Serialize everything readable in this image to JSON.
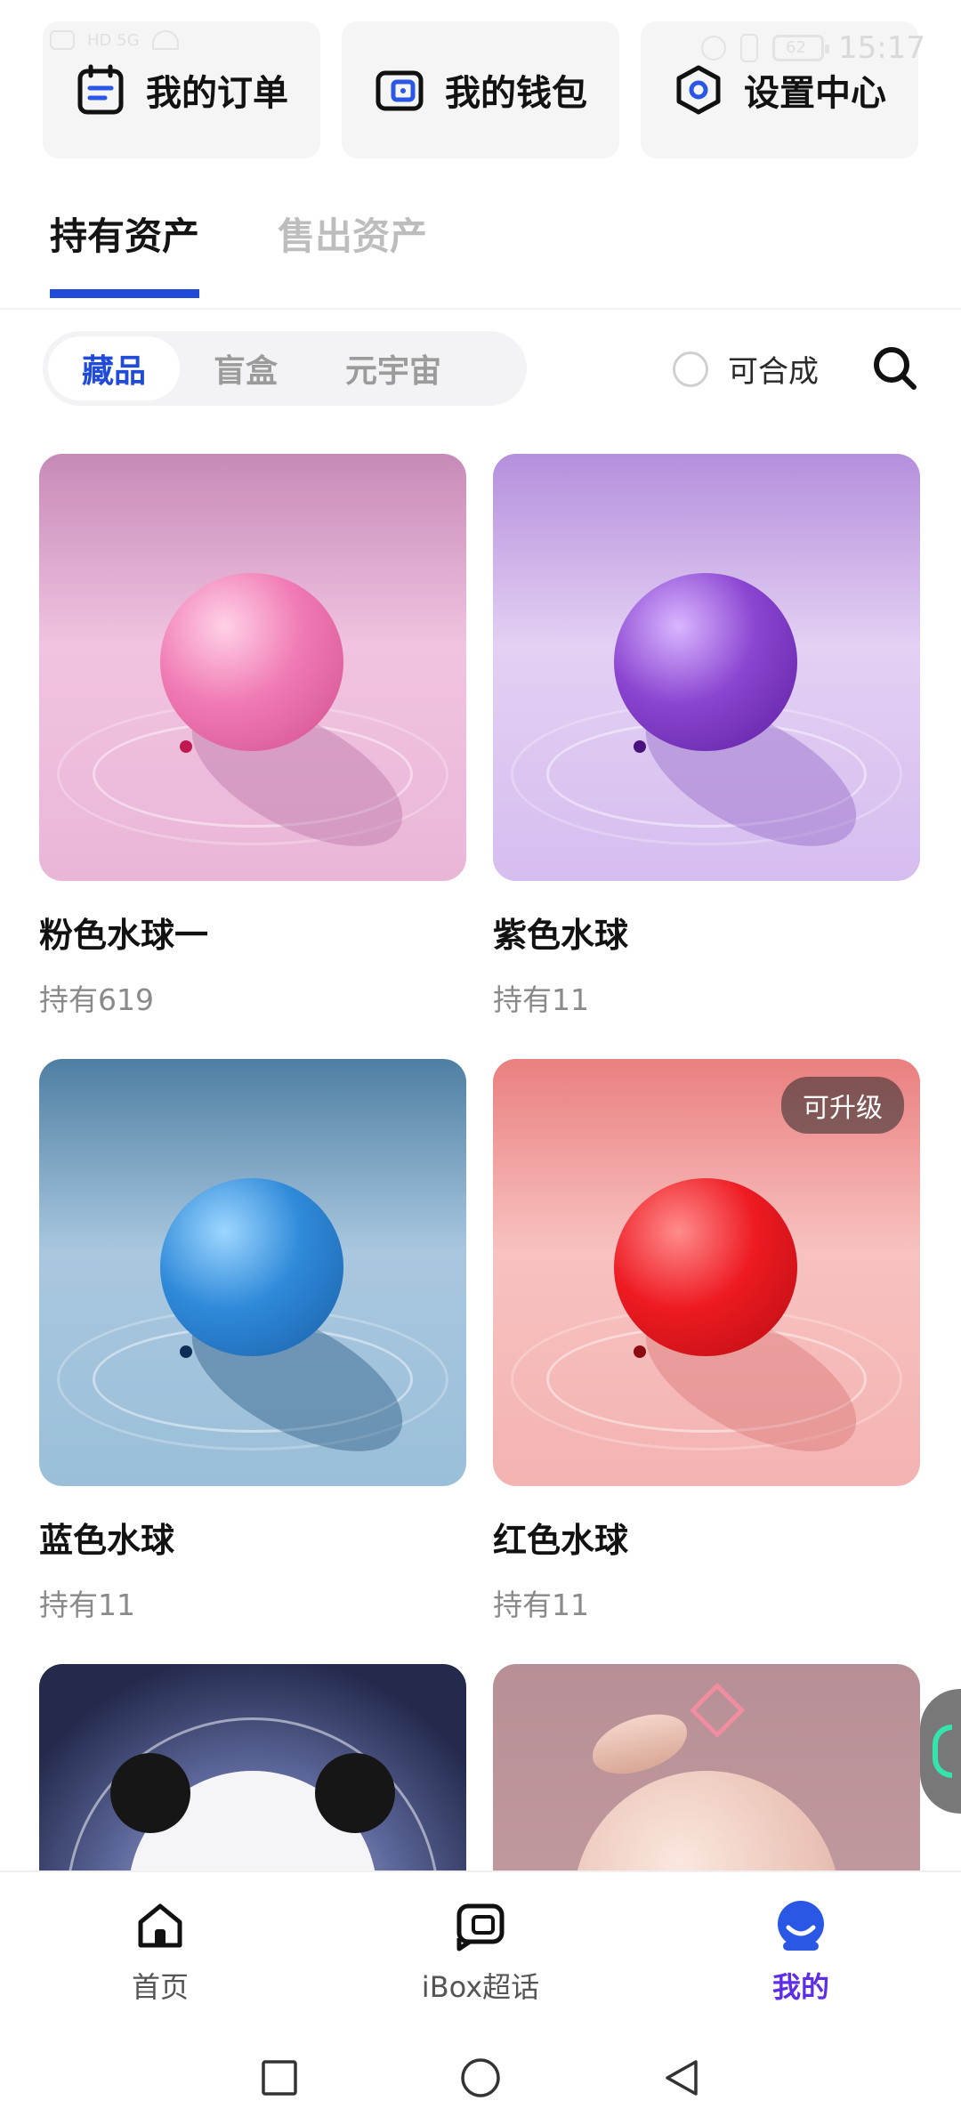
{
  "status_bar": {
    "network_label": "HD 5G",
    "time": "15:17",
    "battery": "62"
  },
  "quick_actions": [
    {
      "label": "我的订单",
      "icon": "order-icon"
    },
    {
      "label": "我的钱包",
      "icon": "wallet-icon"
    },
    {
      "label": "设置中心",
      "icon": "settings-icon"
    }
  ],
  "main_tabs": [
    {
      "label": "持有资产",
      "active": true
    },
    {
      "label": "售出资产",
      "active": false
    }
  ],
  "filter": {
    "segments": [
      {
        "label": "藏品",
        "active": true
      },
      {
        "label": "盲盒",
        "active": false
      },
      {
        "label": "元宇宙",
        "active": false
      }
    ],
    "composable_label": "可合成",
    "composable_checked": false
  },
  "items": [
    {
      "title": "粉色水球一",
      "holding": "持有619",
      "color": "#e86aa7",
      "bg": "#e9b2d6",
      "badge": ""
    },
    {
      "title": "紫色水球",
      "holding": "持有11",
      "color": "#7b3dc3",
      "bg": "#cfb2e6",
      "badge": ""
    },
    {
      "title": "蓝色水球",
      "holding": "持有11",
      "color": "#2d86d6",
      "bg": "#8fb7d8",
      "badge": ""
    },
    {
      "title": "红色水球",
      "holding": "持有11",
      "color": "#e3141c",
      "bg": "#f1a9a8",
      "badge": "可升级"
    }
  ],
  "bottom_nav": [
    {
      "label": "首页",
      "icon": "home-icon",
      "active": false
    },
    {
      "label": "iBox超话",
      "icon": "chat-icon",
      "active": false
    },
    {
      "label": "我的",
      "icon": "profile-icon",
      "active": true
    }
  ]
}
